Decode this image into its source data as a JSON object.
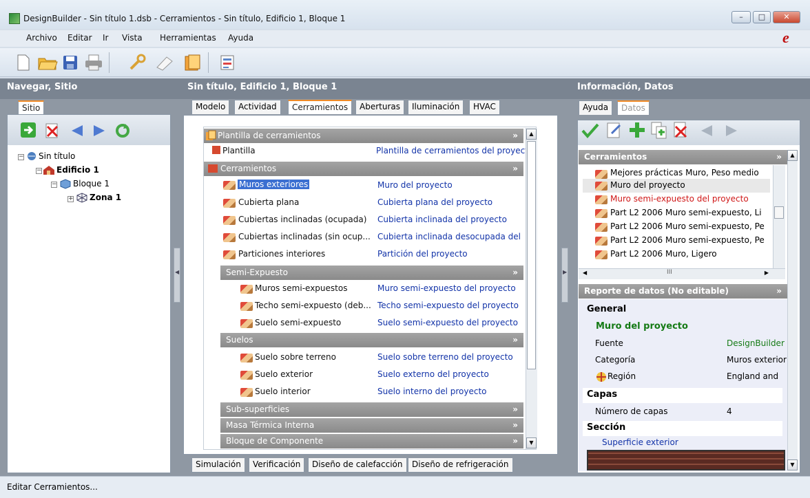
{
  "window": {
    "title": "DesignBuilder - Sin título 1.dsb - Cerramientos - Sin título, Edificio 1, Bloque 1",
    "logo": "e"
  },
  "menu": [
    "Archivo",
    "Editar",
    "Ir",
    "Vista",
    "Herramientas",
    "Ayuda"
  ],
  "toolbar_icons": [
    "new-file-icon",
    "open-folder-icon",
    "save-icon",
    "print-icon",
    "wrench-icon",
    "eraser-icon",
    "templates-icon",
    "model-options-icon"
  ],
  "left": {
    "header": "Navegar, Sitio",
    "tab": "Sitio",
    "tree": [
      {
        "label": "Sin título",
        "level": 0,
        "bold": false
      },
      {
        "label": "Edificio 1",
        "level": 1,
        "bold": true
      },
      {
        "label": "Bloque 1",
        "level": 2,
        "bold": false
      },
      {
        "label": "Zona 1",
        "level": 3,
        "bold": true
      }
    ]
  },
  "center": {
    "header": "Sin título, Edificio 1, Bloque 1",
    "tabs": [
      "Modelo",
      "Actividad",
      "Cerramientos",
      "Aberturas",
      "Iluminación",
      "HVAC"
    ],
    "active_tab": "Cerramientos",
    "bottom_tabs": [
      "Simulación",
      "Verificación",
      "Diseño de calefacción",
      "Diseño de refrigeración"
    ],
    "template_group": "Plantilla de cerramientos",
    "template_row": {
      "name": "Plantilla",
      "value": "Plantilla de cerramientos del proyect"
    },
    "constructions_group": "Cerramientos",
    "rows": [
      {
        "name": "Muros exteriores",
        "value": "Muro del proyecto",
        "selected": true
      },
      {
        "name": "Cubierta plana",
        "value": "Cubierta plana del proyecto"
      },
      {
        "name": "Cubiertas inclinadas (ocupada)",
        "value": "Cubierta inclinada del proyecto"
      },
      {
        "name": "Cubiertas inclinadas (sin ocup...",
        "value": "Cubierta inclinada desocupada del"
      },
      {
        "name": "Particiones interiores",
        "value": "Partición del proyecto"
      }
    ],
    "semi_group": "Semi-Expuesto",
    "semi_rows": [
      {
        "name": "Muros semi-expuestos",
        "value": "Muro semi-expuesto del proyecto"
      },
      {
        "name": "Techo semi-expuesto (deb...",
        "value": "Techo semi-expuesto del proyecto"
      },
      {
        "name": "Suelo semi-expuesto",
        "value": "Suelo semi-expuesto del proyecto"
      }
    ],
    "floors_group": "Suelos",
    "floor_rows": [
      {
        "name": "Suelo sobre terreno",
        "value": "Suelo sobre terreno del proyecto"
      },
      {
        "name": "Suelo exterior",
        "value": "Suelo externo del proyecto"
      },
      {
        "name": "Suelo interior",
        "value": "Suelo interno del proyecto"
      }
    ],
    "collapsed_groups": [
      "Sub-superficies",
      "Masa Térmica Interna",
      "Bloque de Componente"
    ]
  },
  "right": {
    "header": "Información, Datos",
    "tabs": [
      "Ayuda",
      "Datos"
    ],
    "list_header": "Cerramientos",
    "list": [
      {
        "label": "Mejores prácticas Muro, Peso medio"
      },
      {
        "label": "Muro del proyecto",
        "selected": true
      },
      {
        "label": "Muro semi-expuesto del proyecto",
        "red": true
      },
      {
        "label": "Part L2 2006 Muro semi-expuesto, Li"
      },
      {
        "label": "Part L2 2006 Muro semi-expuesto, Pe"
      },
      {
        "label": "Part L2 2006 Muro semi-expuesto, Pe"
      },
      {
        "label": "Part L2 2006 Muro, Ligero"
      }
    ],
    "report_header": "Reporte de datos (No editable)",
    "general": "General",
    "item_name": "Muro del proyecto",
    "props": [
      {
        "k": "Fuente",
        "v": "DesignBuilder",
        "green": true
      },
      {
        "k": "Categoría",
        "v": "Muros exterior"
      },
      {
        "k": "Región",
        "v": "England and"
      }
    ],
    "layers": "Capas",
    "layers_prop": {
      "k": "Número de capas",
      "v": "4"
    },
    "section": "Sección",
    "section_sub": "Superficie exterior"
  },
  "status": "Editar Cerramientos..."
}
